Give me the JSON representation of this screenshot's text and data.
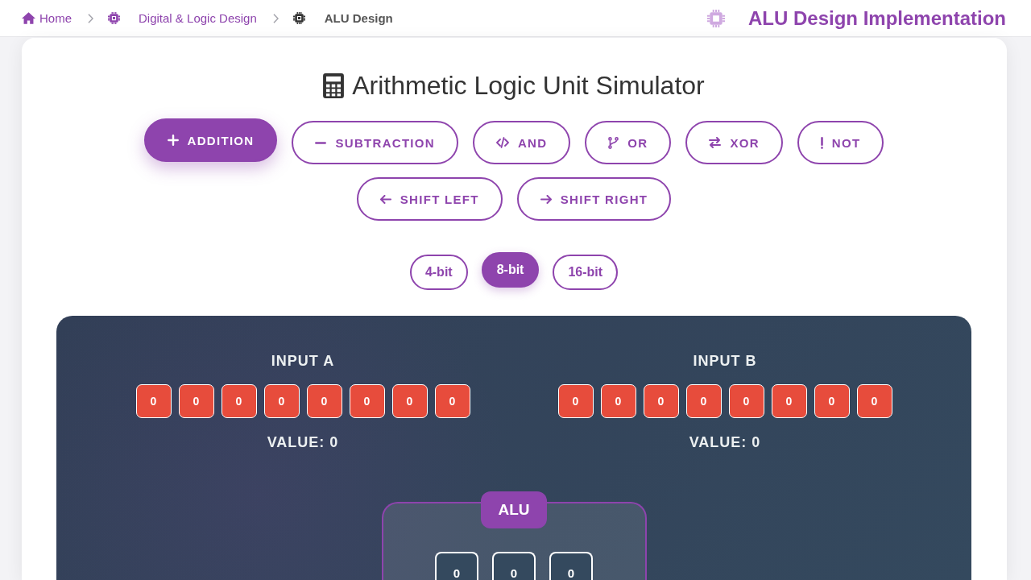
{
  "breadcrumb": [
    {
      "label": "Home",
      "current": false
    },
    {
      "label": "Digital & Logic Design",
      "current": false
    },
    {
      "label": "ALU Design",
      "current": true
    }
  ],
  "page_title": "ALU Design Implementation",
  "simulator": {
    "title": "Arithmetic Logic Unit Simulator",
    "operations": [
      {
        "label": "ADDITION",
        "selected": true
      },
      {
        "label": "SUBTRACTION",
        "selected": false
      },
      {
        "label": "AND",
        "selected": false
      },
      {
        "label": "OR",
        "selected": false
      },
      {
        "label": "XOR",
        "selected": false
      },
      {
        "label": "NOT",
        "selected": false
      },
      {
        "label": "SHIFT LEFT",
        "selected": false
      },
      {
        "label": "SHIFT RIGHT",
        "selected": false
      }
    ],
    "bit_widths": [
      {
        "label": "4-bit",
        "selected": false
      },
      {
        "label": "8-bit",
        "selected": true
      },
      {
        "label": "16-bit",
        "selected": false
      }
    ],
    "inputs": [
      {
        "label": "INPUT A",
        "bits": [
          {
            "text": "0",
            "on": false
          },
          {
            "text": "0",
            "on": false
          },
          {
            "text": "0",
            "on": false
          },
          {
            "text": "0",
            "on": false
          },
          {
            "text": "0",
            "on": false
          },
          {
            "text": "0",
            "on": false
          },
          {
            "text": "0",
            "on": false
          },
          {
            "text": "0",
            "on": false
          }
        ],
        "value": "VALUE: 0"
      },
      {
        "label": "INPUT B",
        "bits": [
          {
            "text": "0",
            "on": false
          },
          {
            "text": "0",
            "on": false
          },
          {
            "text": "0",
            "on": false
          },
          {
            "text": "0",
            "on": false
          },
          {
            "text": "0",
            "on": false
          },
          {
            "text": "0",
            "on": false
          },
          {
            "text": "0",
            "on": false
          },
          {
            "text": "0",
            "on": false
          }
        ],
        "value": "VALUE: 0"
      }
    ],
    "alu": {
      "label": "ALU",
      "cells": [
        "0",
        "0",
        "0"
      ]
    }
  }
}
